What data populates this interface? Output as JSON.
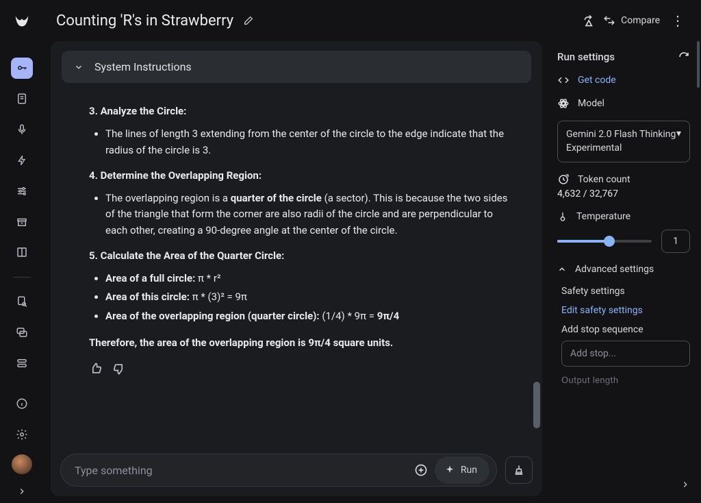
{
  "header": {
    "title": "Counting 'R's in Strawberry",
    "compare_label": "Compare"
  },
  "sidebar": {
    "icons": [
      "key",
      "doc",
      "mic",
      "bolt",
      "sliders",
      "archive",
      "book",
      "search-doc",
      "chat",
      "stack",
      "info",
      "gear"
    ]
  },
  "system_instructions": {
    "label": "System Instructions"
  },
  "message": {
    "h3": "3. Analyze the Circle:",
    "p3": "The lines of length 3 extending from the center of the circle to the edge indicate that the radius of the circle is 3.",
    "h4": "4. Determine the Overlapping Region:",
    "p4a": "The overlapping region is a ",
    "p4b": "quarter of the circle",
    "p4c": " (a sector). This is because the two sides of the triangle that form the corner are also radii of the circle and are perpendicular to each other, creating a 90-degree angle at the center of the circle.",
    "h5": "5. Calculate the Area of the Quarter Circle:",
    "li5a_b": "Area of a full circle:",
    "li5a_t": " π * r²",
    "li5b_b": "Area of this circle:",
    "li5b_t": " π * (3)² = 9π",
    "li5c_b": "Area of the overlapping region (quarter circle):",
    "li5c_t": " (1/4) * 9π = ",
    "li5c_r": "9π/4",
    "conclusion": "Therefore, the area of the overlapping region is 9π/4 square units."
  },
  "input": {
    "placeholder": "Type something",
    "run_label": "Run"
  },
  "settings": {
    "title": "Run settings",
    "get_code": "Get code",
    "model_label": "Model",
    "model_name": "Gemini 2.0 Flash Thinking Experimental",
    "token_label": "Token count",
    "token_value": "4,632 / 32,767",
    "temperature_label": "Temperature",
    "temperature_value": "1",
    "advanced_label": "Advanced settings",
    "safety_label": "Safety settings",
    "edit_safety": "Edit safety settings",
    "stop_label": "Add stop sequence",
    "stop_placeholder": "Add stop...",
    "output_length_faint": "Output length"
  }
}
